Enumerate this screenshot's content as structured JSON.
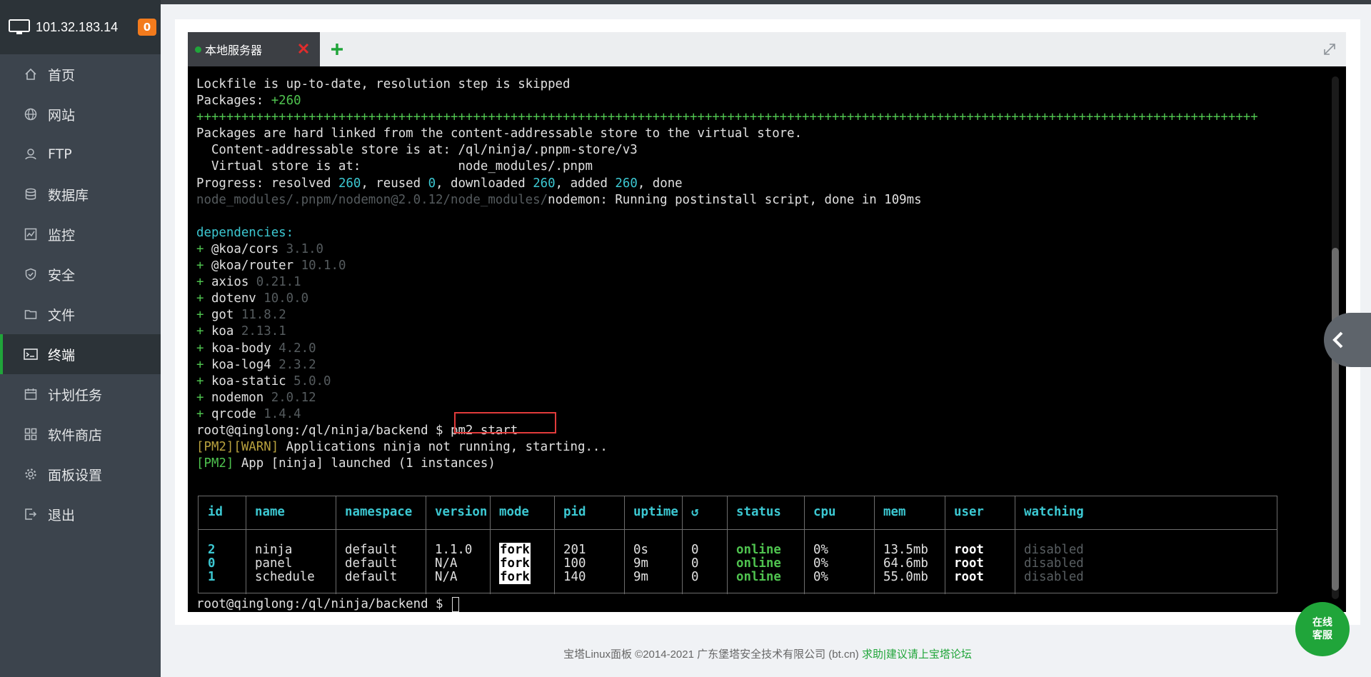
{
  "server": {
    "ip": "101.32.183.14",
    "badge": "0"
  },
  "nav": [
    {
      "label": "首页",
      "icon": "home-icon"
    },
    {
      "label": "网站",
      "icon": "globe-icon"
    },
    {
      "label": "FTP",
      "icon": "ftp-icon"
    },
    {
      "label": "数据库",
      "icon": "database-icon"
    },
    {
      "label": "监控",
      "icon": "monitor-chart-icon"
    },
    {
      "label": "安全",
      "icon": "shield-icon"
    },
    {
      "label": "文件",
      "icon": "folder-icon"
    },
    {
      "label": "终端",
      "icon": "terminal-icon",
      "active": true
    },
    {
      "label": "计划任务",
      "icon": "calendar-icon"
    },
    {
      "label": "软件商店",
      "icon": "grid-icon"
    },
    {
      "label": "面板设置",
      "icon": "gear-icon"
    },
    {
      "label": "退出",
      "icon": "logout-icon"
    }
  ],
  "tab": {
    "label": "本地服务器"
  },
  "terminal": {
    "l1": "Lockfile is up-to-date, resolution step is skipped",
    "l2a": "Packages: ",
    "l2b": "+260",
    "plusline": "++++++++++++++++++++++++++++++++++++++++++++++++++++++++++++++++++++++++++++++++++++++++++++++++++++++++++++++++++++++++++++++++++++++++++++++",
    "l4": "Packages are hard linked from the content-addressable store to the virtual store.",
    "l5": "  Content-addressable store is at: /ql/ninja/.pnpm-store/v3",
    "l6": "  Virtual store is at:             node_modules/.pnpm",
    "l7": {
      "a": "Progress: resolved ",
      "n1": "260",
      "b": ", reused ",
      "n2": "0",
      "c": ", downloaded ",
      "n3": "260",
      "d": ", added ",
      "n4": "260",
      "e": ", done"
    },
    "l8a": "node_modules/.pnpm/nodemon@2.0.12/node_modules/",
    "l8b": "nodemon: Running postinstall script, done in 109ms",
    "deps_header": "dependencies:",
    "deps": [
      {
        "name": "@koa/cors",
        "ver": "3.1.0"
      },
      {
        "name": "@koa/router",
        "ver": "10.1.0"
      },
      {
        "name": "axios",
        "ver": "0.21.1"
      },
      {
        "name": "dotenv",
        "ver": "10.0.0"
      },
      {
        "name": "got",
        "ver": "11.8.2"
      },
      {
        "name": "koa",
        "ver": "2.13.1"
      },
      {
        "name": "koa-body",
        "ver": "4.2.0"
      },
      {
        "name": "koa-log4",
        "ver": "2.3.2"
      },
      {
        "name": "koa-static",
        "ver": "5.0.0"
      },
      {
        "name": "nodemon",
        "ver": "2.0.12"
      },
      {
        "name": "qrcode",
        "ver": "1.4.4"
      }
    ],
    "prompt": "root@qinglong:/ql/ninja/backend $ ",
    "command": "pm2 start",
    "warn_a": "[PM2][WARN]",
    "warn_b": " Applications ninja not running, starting...",
    "launch_a": "[PM2]",
    "launch_b": " App [ninja] launched (1 instances)",
    "table": {
      "headers": [
        "id",
        "name",
        "namespace",
        "version",
        "mode",
        "pid",
        "uptime",
        "↺",
        "status",
        "cpu",
        "mem",
        "user",
        "watching"
      ],
      "rows": [
        [
          "2",
          "ninja",
          "default",
          "1.1.0",
          "fork",
          "201",
          "0s",
          "0",
          "online",
          "0%",
          "13.5mb",
          "root",
          "disabled"
        ],
        [
          "0",
          "panel",
          "default",
          "N/A",
          "fork",
          "100",
          "9m",
          "0",
          "online",
          "0%",
          "64.6mb",
          "root",
          "disabled"
        ],
        [
          "1",
          "schedule",
          "default",
          "N/A",
          "fork",
          "140",
          "9m",
          "0",
          "online",
          "0%",
          "55.0mb",
          "root",
          "disabled"
        ]
      ]
    },
    "final_prompt": "root@qinglong:/ql/ninja/backend $ "
  },
  "footer": {
    "text": "宝塔Linux面板 ©2014-2021 广东堡塔安全技术有限公司 (bt.cn)",
    "link": "求助|建议请上宝塔论坛"
  },
  "service": {
    "line1": "在线",
    "line2": "客服"
  },
  "colors": {
    "accent": "#20a53a",
    "sidebar": "#3c444d",
    "badge": "#f37b1d"
  }
}
